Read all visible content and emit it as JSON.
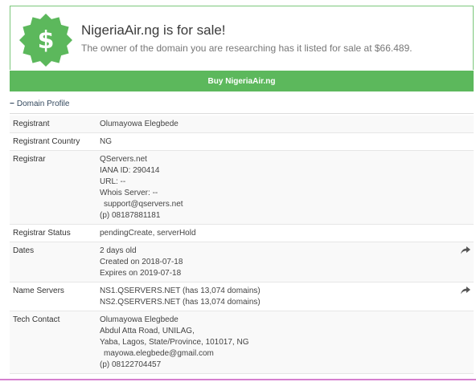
{
  "sale": {
    "title": "NigeriaAir.ng is for sale!",
    "subtitle": "The owner of the domain you are researching has it listed for sale at $66.489.",
    "button_label": "Buy NigeriaAir.ng",
    "badge_symbol": "$",
    "badge_color": "#5cb85c"
  },
  "profile": {
    "header": "Domain Profile",
    "header_icon": "minus-icon",
    "rows": [
      {
        "label": "Registrant",
        "lines": [
          "Olumayowa Elegbede"
        ]
      },
      {
        "label": "Registrant Country",
        "lines": [
          "NG"
        ]
      },
      {
        "label": "Registrar",
        "lines": [
          "QServers.net",
          "IANA ID: 290414",
          "URL: --",
          "Whois Server: --"
        ],
        "email": "support@qservers.net",
        "phone": "(p) 08187881181"
      },
      {
        "label": "Registrar Status",
        "lines": [
          "pendingCreate, serverHold"
        ]
      },
      {
        "label": "Dates",
        "lines": [
          "2 days old",
          "Created on 2018-07-18",
          "Expires on 2019-07-18"
        ],
        "action": "share-icon"
      },
      {
        "label": "Name Servers",
        "lines": [
          "NS1.QSERVERS.NET (has 13,074 domains)",
          "NS2.QSERVERS.NET (has 13,074 domains)"
        ],
        "action": "share-icon"
      },
      {
        "label": "Tech Contact",
        "lines": [
          "Olumayowa Elegbede",
          "Abdul Atta Road, UNILAG,",
          "Yaba, Lagos, State/Province, 101017, NG"
        ],
        "email": "mayowa.elegbede@gmail.com",
        "phone": "(p) 08122704457"
      }
    ]
  }
}
